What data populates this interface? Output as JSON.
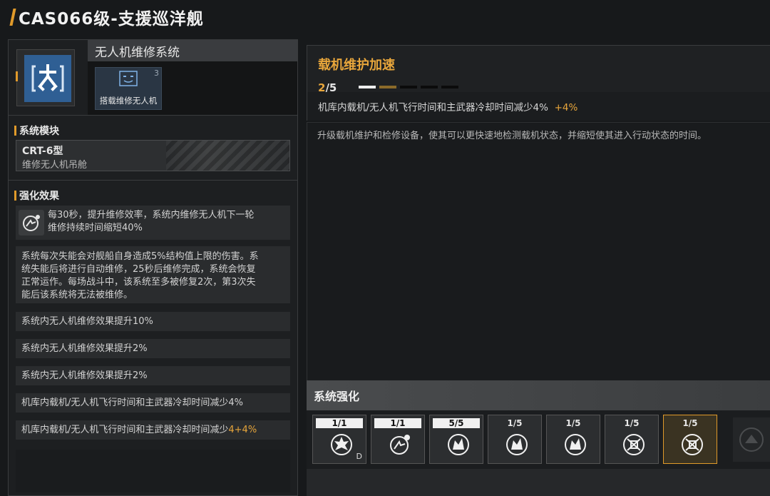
{
  "header": {
    "title": "CAS066级-支援巡洋舰"
  },
  "system": {
    "name": "无人机维修系统",
    "drone_card": {
      "label": "搭载维修无人机",
      "count": "3",
      "icon": "drone-face-icon"
    },
    "icon": "repair-drone-system-icon"
  },
  "module": {
    "heading": "系统模块",
    "code": "CRT-6型",
    "name": "维修无人机吊舱"
  },
  "effects": {
    "heading": "强化效果",
    "first": {
      "icon": "repair-boost-icon",
      "line1": "每30秒，提升维修效率，系统内维修无人机下一轮",
      "line2": "维修持续时间缩短40%"
    },
    "long_lines": [
      "系统每次失能会对舰船自身造成5%结构值上限的伤害。系",
      "统失能后将进行自动维修，25秒后维修完成，系统会恢复",
      "正常运作。每场战斗中，该系统至多被修复2次，第3次失",
      "能后该系统将无法被维修。"
    ],
    "rows": [
      {
        "text": "系统内无人机维修效果提升10%",
        "bonus": ""
      },
      {
        "text": "系统内无人机维修效果提升2%",
        "bonus": ""
      },
      {
        "text": "系统内无人机维修效果提升2%",
        "bonus": ""
      },
      {
        "text": "机库内载机/无人机飞行时间和主武器冷却时间减少4%",
        "bonus": ""
      },
      {
        "text": "机库内载机/无人机飞行时间和主武器冷却时间减少",
        "bonus": "4+4%"
      }
    ]
  },
  "detail": {
    "title": "载机维护加速",
    "level_current": "2",
    "level_max": "/5",
    "level_value": 2,
    "level_total": 5,
    "effect_text": "机库内载机/无人机飞行时间和主武器冷却时间减少4%",
    "effect_bonus": "+4%",
    "description": "升级载机维护和检修设备，使其可以更快速地检测载机状态，并缩短使其进入行动状态的时间。"
  },
  "enhance": {
    "heading": "系统强化",
    "tiles": [
      {
        "level": "1/1",
        "maxed": true,
        "icon": "burst-upgrade-icon",
        "suffix": "D",
        "selected": false
      },
      {
        "level": "1/1",
        "maxed": true,
        "icon": "repair-boost-icon",
        "suffix": "",
        "selected": false
      },
      {
        "level": "5/5",
        "maxed": true,
        "icon": "repair-flash-icon",
        "suffix": "",
        "selected": false
      },
      {
        "level": "1/5",
        "maxed": false,
        "icon": "repair-flash-icon",
        "suffix": "",
        "selected": false
      },
      {
        "level": "1/5",
        "maxed": false,
        "icon": "repair-flash-icon",
        "suffix": "",
        "selected": false
      },
      {
        "level": "1/5",
        "maxed": false,
        "icon": "hangar-speed-icon",
        "suffix": "",
        "selected": false
      },
      {
        "level": "1/5",
        "maxed": false,
        "icon": "hangar-speed-icon",
        "suffix": "",
        "selected": true
      }
    ],
    "locked_icon": "locked-upgrade-icon"
  },
  "colors": {
    "accent": "#e09a2a",
    "bonus": "#e8a63b",
    "system_blue": "#2f5f94"
  }
}
